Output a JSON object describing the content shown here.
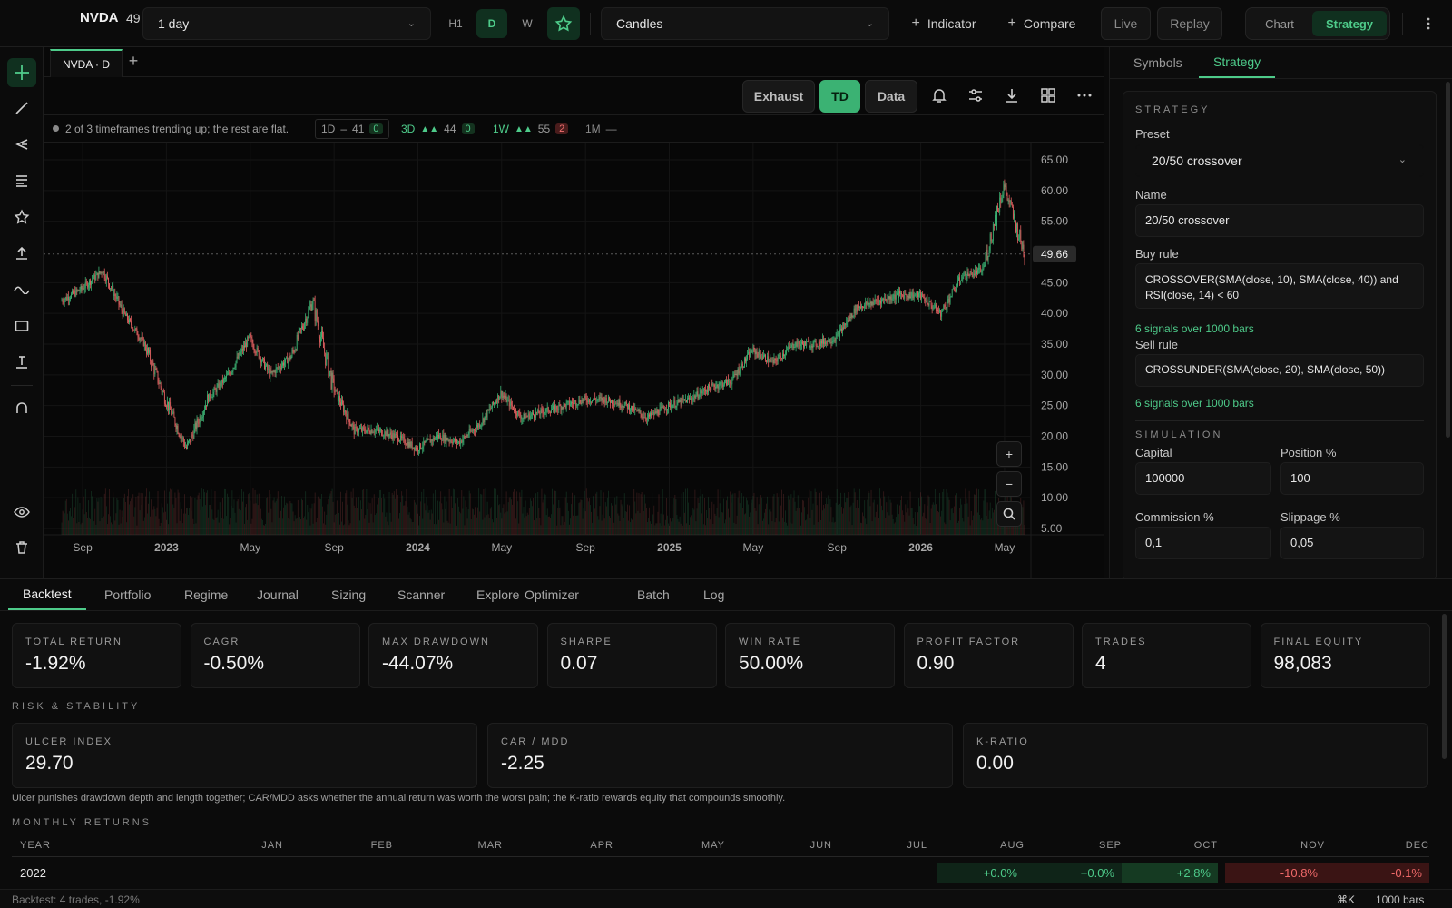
{
  "topbar": {
    "ticker": "NVDA",
    "price_fragment": "49",
    "interval": "1 day",
    "timeframes": [
      "H1",
      "D",
      "W"
    ],
    "active_timeframe": "D",
    "chart_style": "Candles",
    "indicator_label": "Indicator",
    "compare_label": "Compare",
    "live_label": "Live",
    "replay_label": "Replay",
    "view_tabs": [
      "Chart",
      "Strategy"
    ],
    "active_view": "Strategy"
  },
  "chart": {
    "doc_tab": "NVDA · D",
    "controls": [
      "Exhaust",
      "TD",
      "Data"
    ],
    "active_control": "TD",
    "trend_summary": "2 of 3 timeframes trending up; the rest are flat.",
    "trend_items": [
      {
        "tf": "1D",
        "arrows": "–",
        "value": "41",
        "count": "0",
        "count_color": "g"
      },
      {
        "tf": "3D",
        "arrows": "▲▲",
        "value": "44",
        "count": "0",
        "count_color": "g"
      },
      {
        "tf": "1W",
        "arrows": "▲▲",
        "value": "55",
        "count": "2",
        "count_color": "r"
      },
      {
        "tf": "1M",
        "arrows": "—",
        "value": "",
        "count": "",
        "count_color": ""
      }
    ],
    "last_price": "49.66"
  },
  "chart_data": {
    "type": "candlestick",
    "ylim": [
      5,
      65
    ],
    "ytick_labels": [
      "65.00",
      "60.00",
      "55.00",
      "50.00",
      "45.00",
      "40.00",
      "35.00",
      "30.00",
      "25.00",
      "20.00",
      "15.00",
      "10.00",
      "5.00"
    ],
    "xtick_labels": [
      "Sep",
      "2023",
      "May",
      "Sep",
      "2024",
      "May",
      "Sep",
      "2025",
      "May",
      "Sep",
      "2026",
      "May"
    ],
    "price_path": [
      {
        "x": "2022-08",
        "close": 42
      },
      {
        "x": "2022-09",
        "close": 44
      },
      {
        "x": "2022-10",
        "close": 47
      },
      {
        "x": "2022-11",
        "close": 40
      },
      {
        "x": "2022-12",
        "close": 35
      },
      {
        "x": "2023-01",
        "close": 26
      },
      {
        "x": "2023-02",
        "close": 18
      },
      {
        "x": "2023-03",
        "close": 26
      },
      {
        "x": "2023-04",
        "close": 30
      },
      {
        "x": "2023-05",
        "close": 36
      },
      {
        "x": "2023-06",
        "close": 30
      },
      {
        "x": "2023-07",
        "close": 33
      },
      {
        "x": "2023-08",
        "close": 42
      },
      {
        "x": "2023-09",
        "close": 28
      },
      {
        "x": "2023-10",
        "close": 21
      },
      {
        "x": "2023-11",
        "close": 21
      },
      {
        "x": "2023-12",
        "close": 20
      },
      {
        "x": "2024-01",
        "close": 18
      },
      {
        "x": "2024-02",
        "close": 20
      },
      {
        "x": "2024-03",
        "close": 19
      },
      {
        "x": "2024-04",
        "close": 22
      },
      {
        "x": "2024-05",
        "close": 27
      },
      {
        "x": "2024-06",
        "close": 23
      },
      {
        "x": "2024-07",
        "close": 24
      },
      {
        "x": "2024-08",
        "close": 25
      },
      {
        "x": "2024-09",
        "close": 26
      },
      {
        "x": "2024-10",
        "close": 26
      },
      {
        "x": "2024-11",
        "close": 25
      },
      {
        "x": "2024-12",
        "close": 23
      },
      {
        "x": "2025-01",
        "close": 25
      },
      {
        "x": "2025-02",
        "close": 26
      },
      {
        "x": "2025-03",
        "close": 28
      },
      {
        "x": "2025-04",
        "close": 29
      },
      {
        "x": "2025-05",
        "close": 34
      },
      {
        "x": "2025-06",
        "close": 32
      },
      {
        "x": "2025-07",
        "close": 35
      },
      {
        "x": "2025-08",
        "close": 35
      },
      {
        "x": "2025-09",
        "close": 36
      },
      {
        "x": "2025-10",
        "close": 41
      },
      {
        "x": "2025-11",
        "close": 42
      },
      {
        "x": "2025-12",
        "close": 43
      },
      {
        "x": "2026-01",
        "close": 43
      },
      {
        "x": "2026-02",
        "close": 40
      },
      {
        "x": "2026-03",
        "close": 46
      },
      {
        "x": "2026-04",
        "close": 47
      },
      {
        "x": "2026-05",
        "close": 61
      },
      {
        "x": "2026-06",
        "close": 49.66
      }
    ]
  },
  "right_panel": {
    "tabs": [
      "Symbols",
      "Strategy"
    ],
    "active_tab": "Strategy",
    "strategy_heading": "STRATEGY",
    "preset_label": "Preset",
    "preset_value": "20/50 crossover",
    "name_label": "Name",
    "name_value": "20/50 crossover",
    "buy_label": "Buy rule",
    "buy_value": "CROSSOVER(SMA(close, 10), SMA(close, 40)) and RSI(close, 14) < 60",
    "buy_hint": "6 signals over 1000 bars",
    "sell_label": "Sell rule",
    "sell_value": "CROSSUNDER(SMA(close, 20), SMA(close, 50))",
    "sell_hint": "6 signals over 1000 bars",
    "simulation_heading": "SIMULATION",
    "capital_label": "Capital",
    "capital_value": "100000",
    "position_label": "Position %",
    "position_value": "100",
    "commission_label": "Commission %",
    "commission_value": "0,1",
    "slippage_label": "Slippage %",
    "slippage_value": "0,05"
  },
  "bottom": {
    "tabs": [
      "Backtest",
      "Portfolio",
      "Regime",
      "Journal",
      "Sizing",
      "Scanner",
      "Explore",
      "Optimizer",
      "Batch",
      "Log"
    ],
    "active_tab": "Backtest",
    "metrics": [
      {
        "label": "TOTAL RETURN",
        "value": "-1.92%"
      },
      {
        "label": "CAGR",
        "value": "-0.50%"
      },
      {
        "label": "MAX DRAWDOWN",
        "value": "-44.07%"
      },
      {
        "label": "SHARPE",
        "value": "0.07"
      },
      {
        "label": "WIN RATE",
        "value": "50.00%"
      },
      {
        "label": "PROFIT FACTOR",
        "value": "0.90"
      },
      {
        "label": "TRADES",
        "value": "4"
      },
      {
        "label": "FINAL EQUITY",
        "value": "98,083"
      }
    ],
    "risk_heading": "RISK & STABILITY",
    "risk_metrics": [
      {
        "label": "ULCER INDEX",
        "value": "29.70"
      },
      {
        "label": "CAR / MDD",
        "value": "-2.25"
      },
      {
        "label": "K-RATIO",
        "value": "0.00"
      }
    ],
    "risk_caption": "Ulcer punishes drawdown depth and length together; CAR/MDD asks whether the annual return was worth the worst pain; the K-ratio rewards equity that compounds smoothly.",
    "monthly_heading": "MONTHLY RETURNS",
    "monthly_columns": [
      "YEAR",
      "JAN",
      "FEB",
      "MAR",
      "APR",
      "MAY",
      "JUN",
      "JUL",
      "AUG",
      "SEP",
      "OCT",
      "NOV",
      "DEC"
    ],
    "monthly_rows": [
      {
        "year": "2022",
        "values": [
          "",
          "",
          "",
          "",
          "",
          "",
          "",
          "+0.0%",
          "+0.0%",
          "+2.8%",
          "-10.8%",
          "-0.1%"
        ]
      }
    ]
  },
  "statusbar": {
    "left": "Backtest: 4 trades, -1.92%",
    "shortcut": "⌘K",
    "bars": "1000 bars"
  },
  "colors": {
    "accent": "#4ecb8a",
    "up": "#3bb273",
    "down": "#e06060",
    "background": "#0a0a0a"
  }
}
